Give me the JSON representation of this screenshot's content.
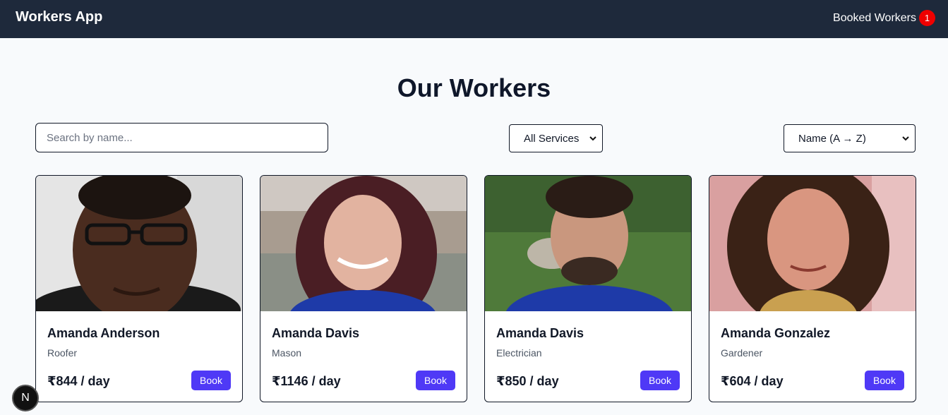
{
  "navbar": {
    "brand": "Workers App",
    "booked_label": "Booked Workers",
    "booked_count": "1"
  },
  "page_title": "Our Workers",
  "filters": {
    "search_placeholder": "Search by name...",
    "service_selected": "All Services",
    "sort_selected": "Name (A → Z)"
  },
  "workers": [
    {
      "name": "Amanda Anderson",
      "role": "Roofer",
      "price": "₹844 / day",
      "book_label": "Book"
    },
    {
      "name": "Amanda Davis",
      "role": "Mason",
      "price": "₹1146 / day",
      "book_label": "Book"
    },
    {
      "name": "Amanda Davis",
      "role": "Electrician",
      "price": "₹850 / day",
      "book_label": "Book"
    },
    {
      "name": "Amanda Gonzalez",
      "role": "Gardener",
      "price": "₹604 / day",
      "book_label": "Book"
    }
  ],
  "dev_badge": {
    "label": "N"
  },
  "colors": {
    "navbar_bg": "#1e293b",
    "badge_red": "#ef0000",
    "book_button": "#4f39f6",
    "page_bg": "#f8fafc"
  }
}
